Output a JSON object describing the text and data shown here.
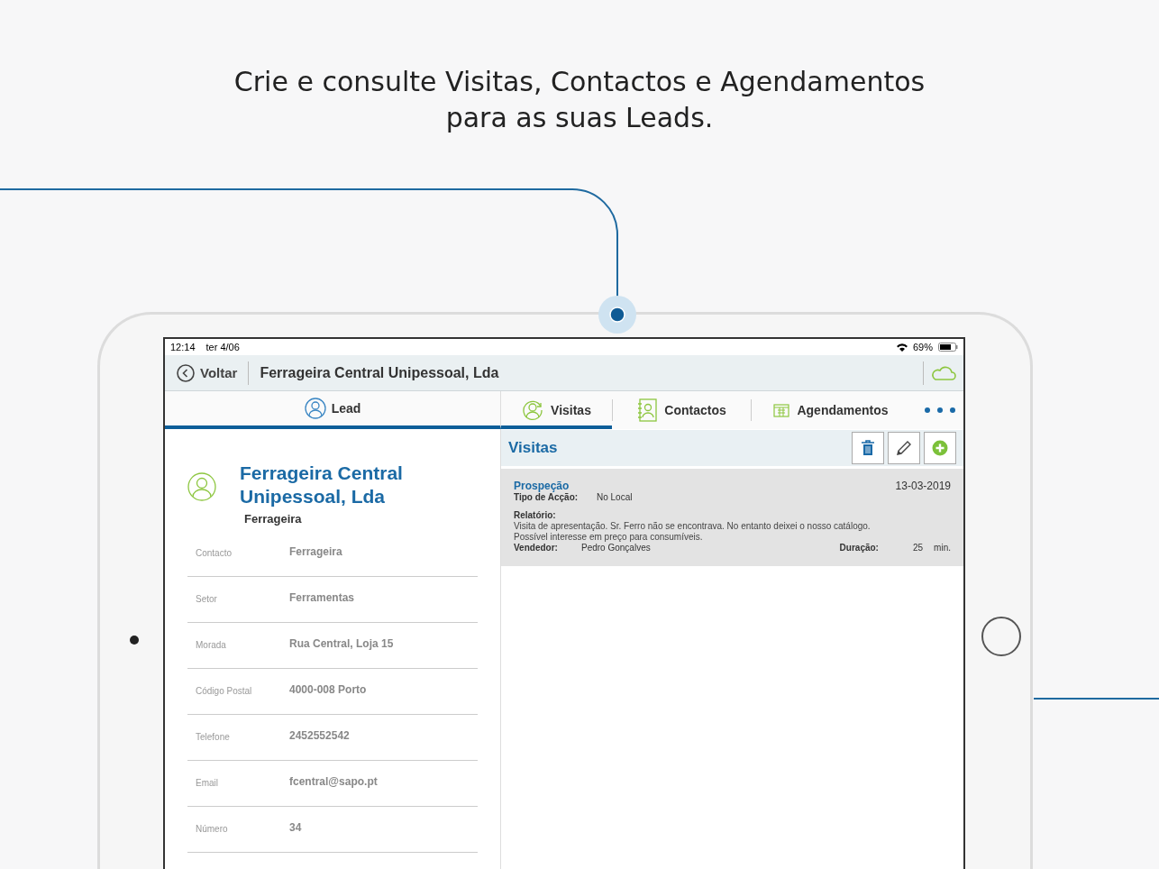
{
  "headline": [
    "Crie e consulte Visitas, Contactos e Agendamentos",
    "para as suas Leads."
  ],
  "status_bar": {
    "time": "12:14",
    "date": "ter 4/06",
    "battery": "69%"
  },
  "nav": {
    "back": "Voltar",
    "title": "Ferrageira Central Unipessoal, Lda"
  },
  "lead_tab": {
    "label": "Lead",
    "selected": true
  },
  "tabs": [
    {
      "label": "Visitas",
      "kind": "visits",
      "selected": true
    },
    {
      "label": "Contactos",
      "kind": "contacts",
      "selected": false
    },
    {
      "label": "Agendamentos",
      "kind": "calendar",
      "selected": false
    }
  ],
  "lead": {
    "name": "Ferrageira Central Unipessoal, Lda",
    "subtitle": "Ferrageira",
    "fields": [
      {
        "label": "Contacto",
        "value": "Ferrageira"
      },
      {
        "label": "Setor",
        "value": "Ferramentas"
      },
      {
        "label": "Morada",
        "value": "Rua Central, Loja 15"
      },
      {
        "label": "Código Postal",
        "value": "4000-008 Porto"
      },
      {
        "label": "Telefone",
        "value": "2452552542"
      },
      {
        "label": "Email",
        "value": "fcentral@sapo.pt"
      },
      {
        "label": "Número",
        "value": "34"
      }
    ]
  },
  "visits": {
    "title": "Visitas",
    "items": [
      {
        "type": "Prospeção",
        "date": "13-03-2019",
        "action_label": "Tipo de Acção:",
        "action": "No Local",
        "report_label": "Relatório:",
        "report_lines": [
          "Visita de apresentação. Sr. Ferro não se encontrava. No entanto deixei o nosso catálogo.",
          "Possível interesse em preço para consumíveis."
        ],
        "seller_label": "Vendedor:",
        "seller": "Pedro Gonçalves",
        "duration_label": "Duração:",
        "duration": "25",
        "unit": "min."
      }
    ]
  }
}
